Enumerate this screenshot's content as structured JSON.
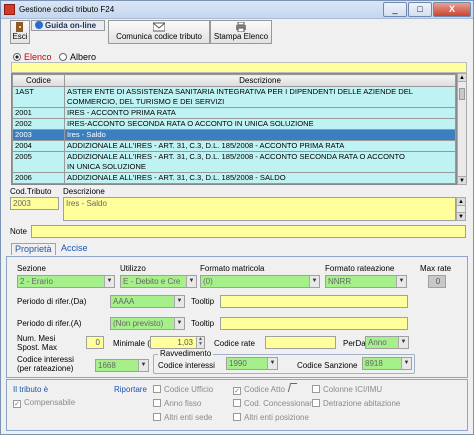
{
  "window": {
    "title": "Gestione codici tributo F24",
    "minimize": "_",
    "maximize": "□",
    "close": "X"
  },
  "toolbar": {
    "esci": "Esci",
    "guida": "Guida on-line",
    "comunica": "Comunica codice tributo",
    "stampa": "Stampa Elenco"
  },
  "view": {
    "elenco": "Elenco",
    "albero": "Albero",
    "selected": "Elenco"
  },
  "table": {
    "columns": [
      "Codice",
      "Descrizione"
    ],
    "rows": [
      {
        "code": "1AST",
        "desc": "ASTER ENTE DI ASSISTENZA SANITARIA INTEGRATIVA PER I DIPENDENTI DELLE AZIENDE DEL\nCOMMERCIO, DEL TURISMO E DEI SERVIZI"
      },
      {
        "code": "2001",
        "desc": "IRES - ACCONTO PRIMA RATA"
      },
      {
        "code": "2002",
        "desc": "IRES-ACCONTO SECONDA RATA O ACCONTO IN UNICA SOLUZIONE"
      },
      {
        "code": "2003",
        "desc": "Ires - Saldo"
      },
      {
        "code": "2004",
        "desc": "ADDIZIONALE ALL'IRES - ART. 31, C.3, D.L. 185/2008 - ACCONTO PRIMA RATA"
      },
      {
        "code": "2005",
        "desc": "ADDIZIONALE ALL'IRES - ART. 31, C.3, D.L. 185/2008 - ACCONTO SECONDA RATA O ACCONTO\nIN UNICA SOLUZIONE"
      },
      {
        "code": "2006",
        "desc": "ADDIZIONALE ALL'IRES - ART. 31, C.3, D.L. 185/2008 - SALDO"
      }
    ],
    "selected_code": "2003"
  },
  "detail": {
    "cod_label": "Cod.Tributo",
    "cod_value": "2003",
    "desc_label": "Descrizione",
    "desc_value": "Ires - Saldo",
    "note_label": "Note",
    "note_value": ""
  },
  "tabs": [
    {
      "label": "Proprietà"
    },
    {
      "label": "Accise"
    }
  ],
  "props": {
    "sezione_label": "Sezione",
    "sezione_value": "2 - Erario",
    "utilizzo_label": "Utilizzo",
    "utilizzo_value": "E - Debito e Cre",
    "formato_matricola_label": "Formato matricola",
    "formato_matricola_value": "(0)",
    "formato_rateazione_label": "Formato rateazione",
    "formato_rateazione_value": "NNRR",
    "max_rate_label": "Max rate",
    "max_rate_value": "0",
    "periodo_da_label": "Periodo di rifer.(Da)",
    "periodo_da_value": "AAAA",
    "periodo_a_label": "Periodo di rifer.(A)",
    "periodo_a_value": "(Non previsto)",
    "tooltip_label": "Tooltip",
    "tooltip1_value": "",
    "tooltip2_value": "",
    "num_mesi_label": "Num. Mesi\nSpost. Max",
    "num_mesi_value": "0",
    "minimale_label": "Minimale (€)",
    "minimale_value": "1,03",
    "codice_rate_label": "Codice rate",
    "codice_rate_value": "",
    "perda_label": "PerDa",
    "perda_value": "Anno",
    "codice_interessi_rate_label": "Codice interessi\n(per rateazione)",
    "codice_interessi_rate_value": "1668",
    "ravvedimento_label": "Ravvedimento",
    "codice_interessi_label": "Codice interessi",
    "codice_interessi_value": "1990",
    "codice_sanzione_label": "Codice Sanzione",
    "codice_sanzione_value": "8918"
  },
  "bottom": {
    "tributo_label": "Il tributo è",
    "compensabile": "Compensabile",
    "riportare_label": "Riportare",
    "checks": [
      "Codice Ufficio",
      "Anno fisso",
      "Altri enti sede",
      "Codice Atto",
      "Cod. Concessionario",
      "Altri enti posizione",
      "Colonne ICI/IMU",
      "Detrazione abitazione"
    ]
  }
}
